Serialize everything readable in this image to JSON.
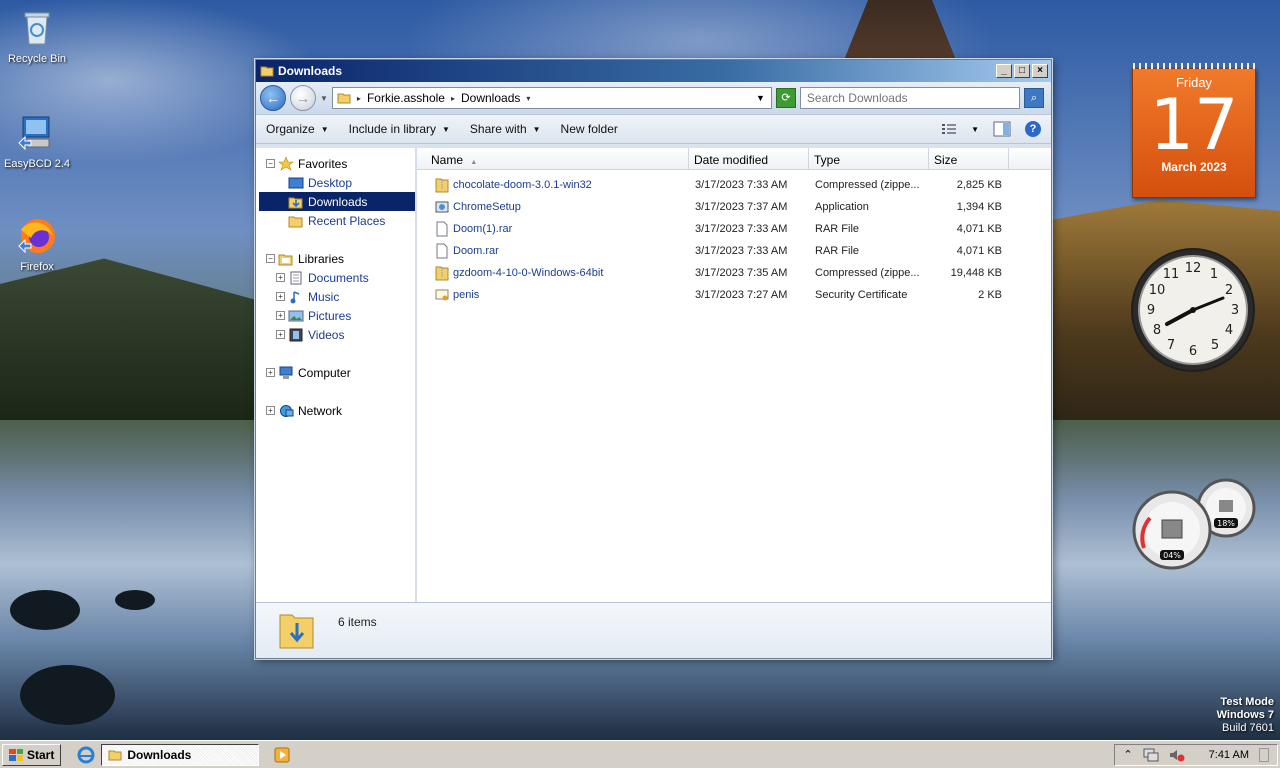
{
  "desktop": {
    "icons": [
      {
        "label": "Recycle Bin",
        "icon": "recycle-bin-icon"
      },
      {
        "label": "EasyBCD 2.4",
        "icon": "easybcd-icon"
      },
      {
        "label": "Firefox",
        "icon": "firefox-icon"
      }
    ],
    "watermark": {
      "line1": "Test Mode",
      "line2": "Windows 7",
      "line3": "Build 7601"
    }
  },
  "window": {
    "title": "Downloads",
    "address": {
      "segments": [
        "Forkie.asshole",
        "Downloads"
      ]
    },
    "search": {
      "placeholder": "Search Downloads"
    },
    "toolbar": {
      "organize": "Organize",
      "include_in_library": "Include in library",
      "share_with": "Share with",
      "new_folder": "New folder"
    },
    "nav": {
      "favorites": "Favorites",
      "desktop": "Desktop",
      "downloads": "Downloads",
      "recent_places": "Recent Places",
      "libraries": "Libraries",
      "documents": "Documents",
      "music": "Music",
      "pictures": "Pictures",
      "videos": "Videos",
      "computer": "Computer",
      "network": "Network"
    },
    "columns": {
      "name": "Name",
      "date": "Date modified",
      "type": "Type",
      "size": "Size"
    },
    "files": [
      {
        "name": "chocolate-doom-3.0.1-win32",
        "date": "3/17/2023 7:33 AM",
        "type": "Compressed (zippe...",
        "size": "2,825 KB",
        "icon": "zip-folder-icon"
      },
      {
        "name": "ChromeSetup",
        "date": "3/17/2023 7:37 AM",
        "type": "Application",
        "size": "1,394 KB",
        "icon": "application-icon"
      },
      {
        "name": "Doom(1).rar",
        "date": "3/17/2023 7:33 AM",
        "type": "RAR File",
        "size": "4,071 KB",
        "icon": "file-icon"
      },
      {
        "name": "Doom.rar",
        "date": "3/17/2023 7:33 AM",
        "type": "RAR File",
        "size": "4,071 KB",
        "icon": "file-icon"
      },
      {
        "name": "gzdoom-4-10-0-Windows-64bit",
        "date": "3/17/2023 7:35 AM",
        "type": "Compressed (zippe...",
        "size": "19,448 KB",
        "icon": "zip-folder-icon"
      },
      {
        "name": "penis",
        "date": "3/17/2023 7:27 AM",
        "type": "Security Certificate",
        "size": "2 KB",
        "icon": "certificate-icon"
      }
    ],
    "status": {
      "count": "6 items"
    }
  },
  "gadgets": {
    "calendar": {
      "weekday": "Friday",
      "day": "17",
      "month": "March 2023"
    },
    "meters": {
      "cpu": "04%",
      "memory": "18%"
    }
  },
  "taskbar": {
    "start": "Start",
    "task": "Downloads",
    "time": "7:41 AM"
  },
  "colors": {
    "accent": "#0a246a",
    "link": "#1a3d8f",
    "calendar": "#e8651c"
  }
}
